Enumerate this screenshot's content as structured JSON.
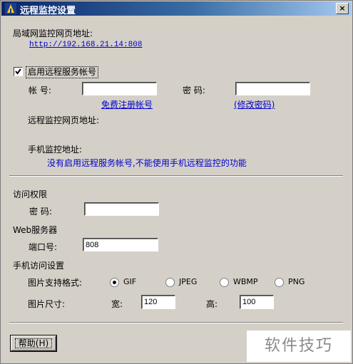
{
  "window": {
    "title": "远程监控设置",
    "close_label": "×"
  },
  "lan": {
    "label": "局域网监控网页地址:",
    "url": "http://192.168.21.14:808"
  },
  "remote": {
    "enable_label": "启用远程服务帐号",
    "enabled": true,
    "account_label": "帐 号:",
    "password_label": "密 码:",
    "account_value": "",
    "password_value": "",
    "register_link": "免费注册帐号",
    "change_password_link": "(修改密码)",
    "web_address_label": "远程监控网页地址:",
    "mobile_address_label": "手机监控地址:",
    "status_message": "没有启用远程服务帐号,不能使用手机远程监控的功能"
  },
  "access": {
    "heading": "访问权限",
    "password_label": "密 码:",
    "password_value": ""
  },
  "webserver": {
    "heading": "Web服务器",
    "port_label": "端口号:",
    "port_value": "808"
  },
  "mobile": {
    "heading": "手机访问设置",
    "format_label": "图片支持格式:",
    "formats": [
      "GIF",
      "JPEG",
      "WBMP",
      "PNG"
    ],
    "selected_format": "GIF",
    "size_label": "图片尺寸:",
    "width_label": "宽:",
    "width_value": "120",
    "height_label": "高:",
    "height_value": "100"
  },
  "help_button": "帮助(H)",
  "watermark_badge": "软件技巧",
  "colors": {
    "title_start": "#0a246a",
    "title_end": "#a6caf0",
    "link": "#0000cc",
    "dialog_bg": "#d4d0c8"
  }
}
